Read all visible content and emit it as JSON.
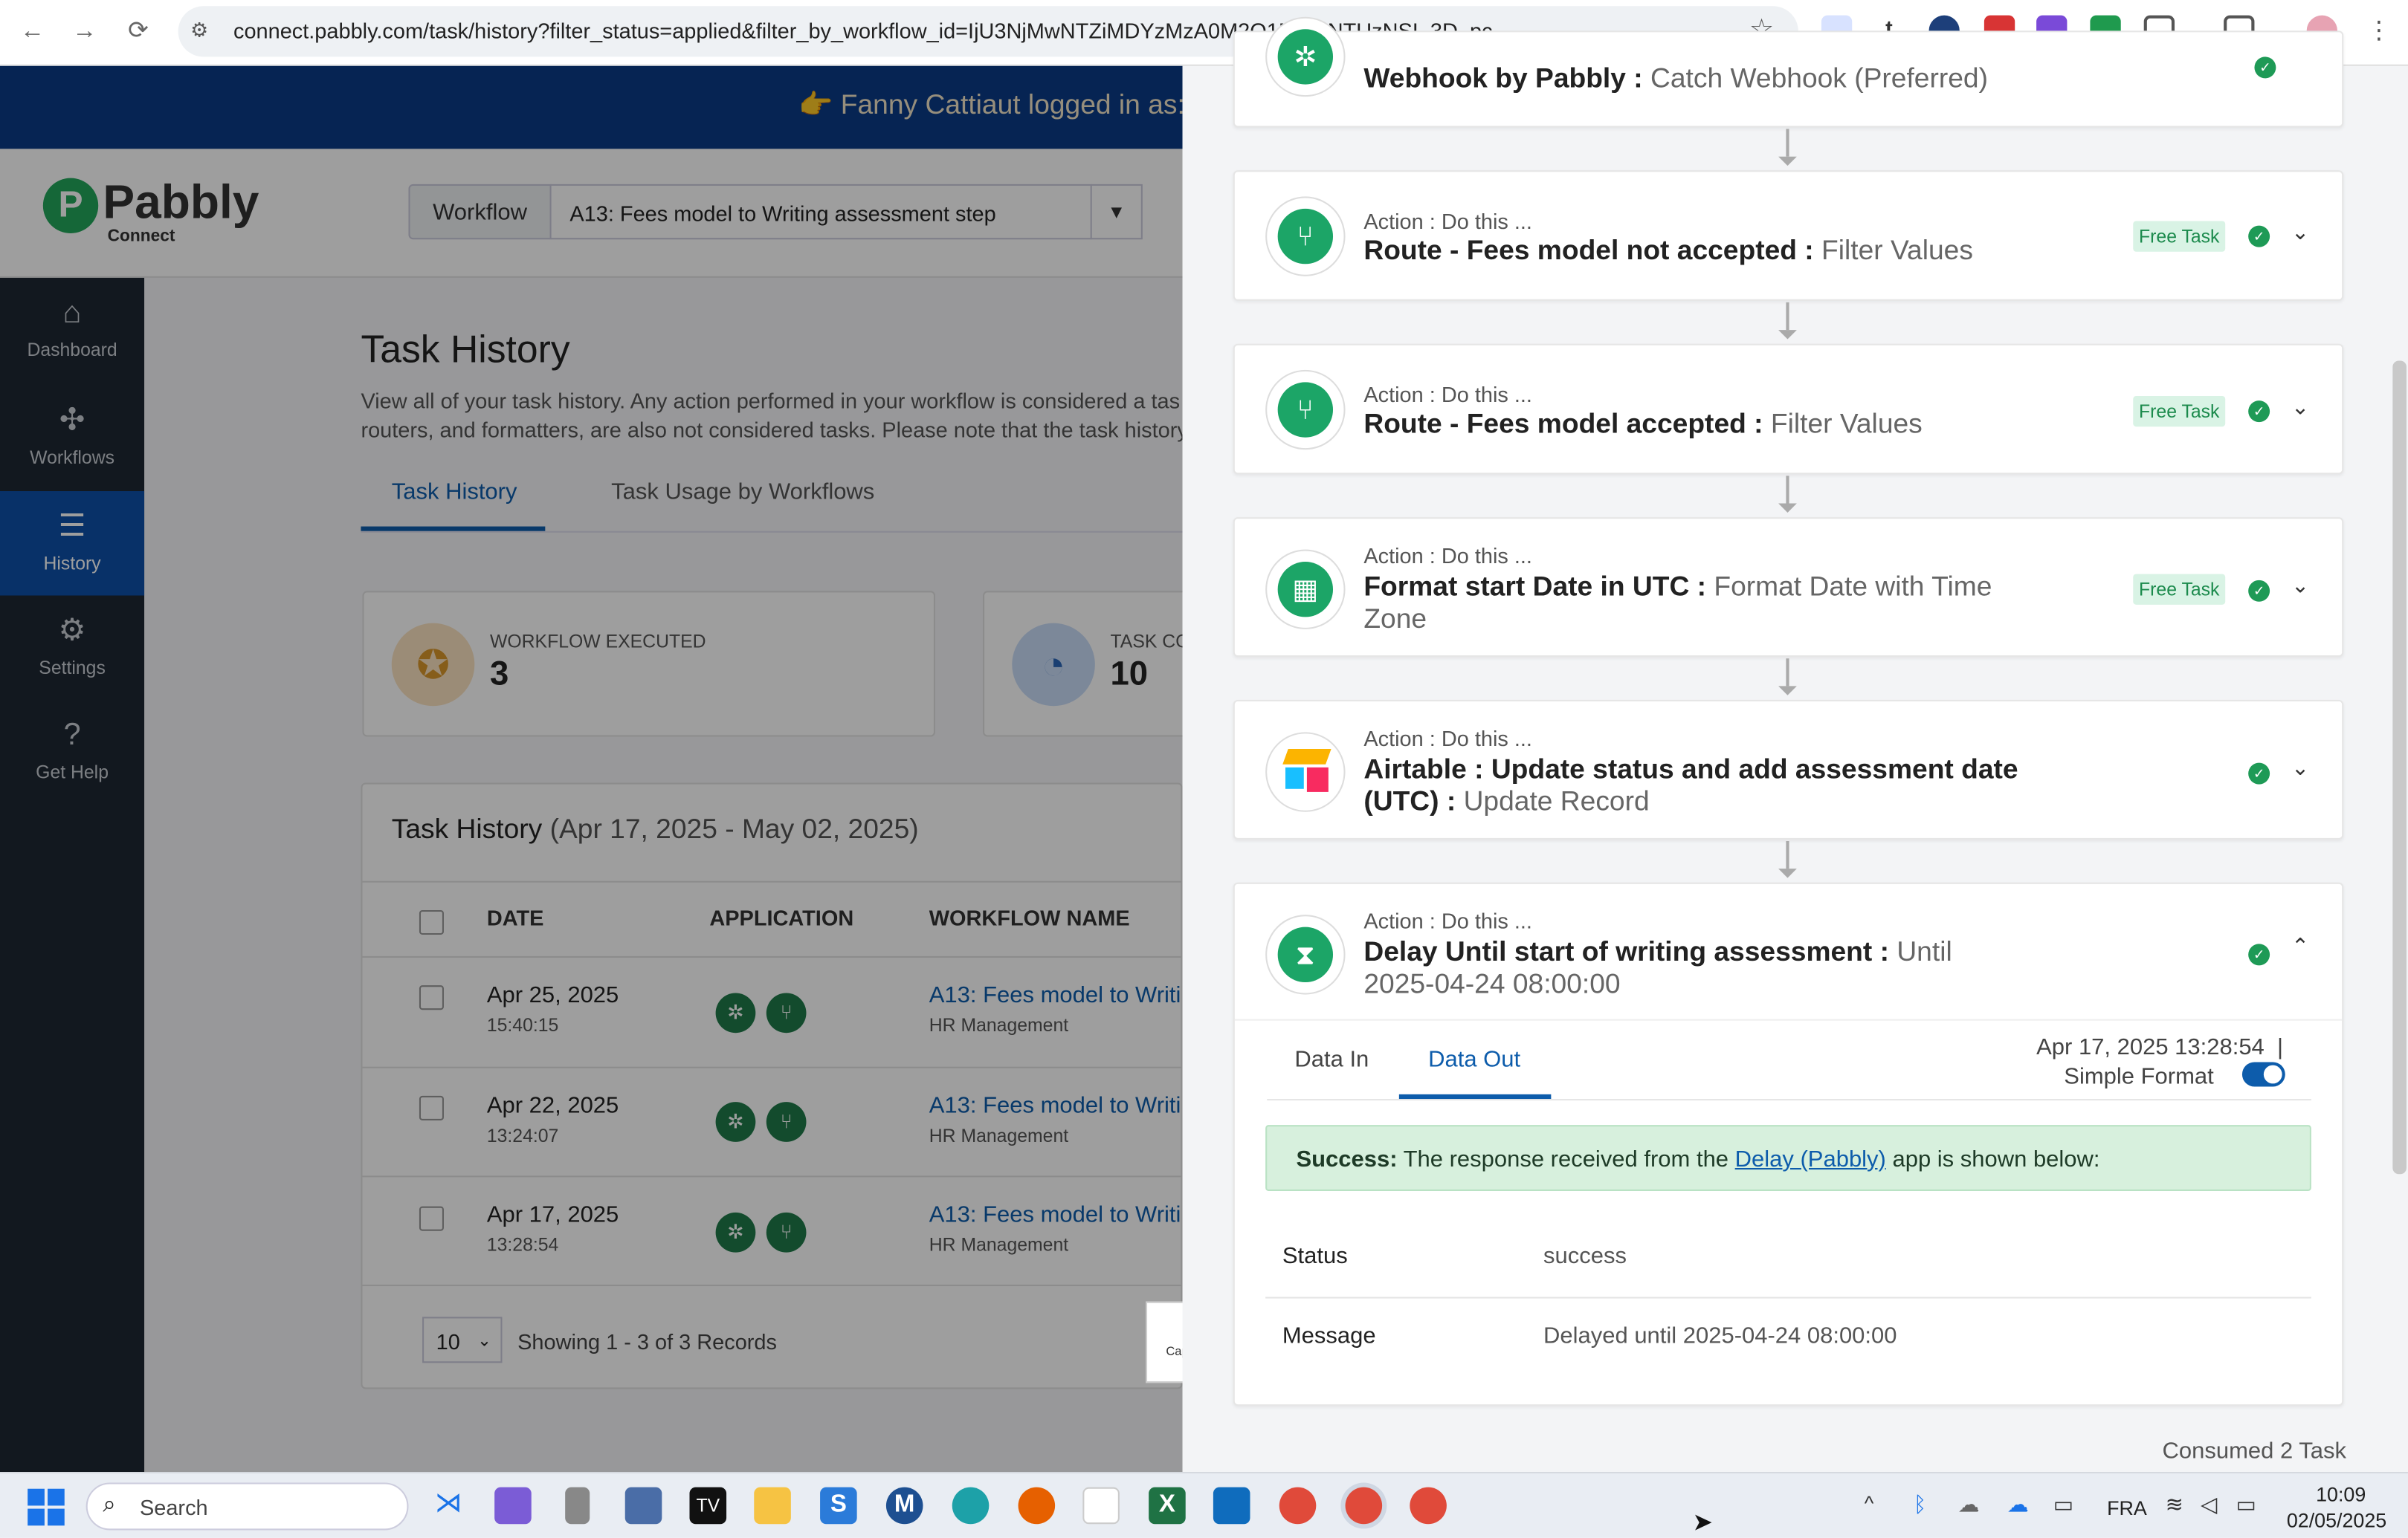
{
  "browser": {
    "url": "connect.pabbly.com/task/history?filter_status=applied&filter_by_workflow_id=IjU3NjMwNTZiMDYzMzA0M2Q1MjY0NTUzNSI_3D_pc"
  },
  "banner": {
    "text": "👉 Fanny Cattiaut logged in as:"
  },
  "logo": {
    "mark": "P",
    "name": "Pabbly",
    "sub": "Connect"
  },
  "workflow_filter": {
    "label": "Workflow",
    "value": "A13: Fees model to Writing assessment step"
  },
  "sidebar": {
    "items": [
      {
        "label": "Dashboard"
      },
      {
        "label": "Workflows"
      },
      {
        "label": "History"
      },
      {
        "label": "Settings"
      },
      {
        "label": "Get Help"
      }
    ]
  },
  "page": {
    "title": "Task History",
    "desc_line1": "View all of your task history. Any action performed in your workflow is considered a tas",
    "desc_line2": "routers, and formatters, are also not considered tasks. Please note that the task history",
    "tabs": [
      "Task History",
      "Task Usage by Workflows"
    ]
  },
  "stats": [
    {
      "label": "WORKFLOW EXECUTED",
      "value": "3"
    },
    {
      "label": "TASK CO",
      "value": "10"
    }
  ],
  "table": {
    "title": "Task History",
    "range": "(Apr 17, 2025 - May 02, 2025)",
    "headers": [
      "DATE",
      "APPLICATION",
      "WORKFLOW NAME"
    ],
    "rows": [
      {
        "date": "Apr 25, 2025",
        "time": "15:40:15",
        "name": "A13: Fees model to Writi",
        "sub": "HR Management"
      },
      {
        "date": "Apr 22, 2025",
        "time": "13:24:07",
        "name": "A13: Fees model to Writi",
        "sub": "HR Management"
      },
      {
        "date": "Apr 17, 2025",
        "time": "13:28:54",
        "name": "A13: Fees model to Writi",
        "sub": "HR Management"
      }
    ],
    "rows_per_page": "10",
    "showing": "Showing 1 - 3 of 3 Records"
  },
  "capslock": {
    "text": "Caps Lock Off"
  },
  "panel": {
    "kicker": "Action : Do this ...",
    "free_badge": "Free Task",
    "steps": [
      {
        "title": "Webhook by Pabbly : ",
        "app": "Catch Webhook (Preferred)"
      },
      {
        "title": "Route - Fees model not accepted : ",
        "app": "Filter Values"
      },
      {
        "title": "Route - Fees model accepted : ",
        "app": "Filter Values"
      },
      {
        "title": "Format start Date in UTC : ",
        "app": "Format Date with Time Zone"
      },
      {
        "title": "Airtable : Update status and add assessment date (UTC) : ",
        "app": "Update Record"
      },
      {
        "title": "Delay Until start of writing assessment : ",
        "app": "Until 2025-04-24 08:00:00"
      }
    ],
    "tabs": {
      "in": "Data In",
      "out": "Data Out"
    },
    "timestamp": "Apr 17, 2025 13:28:54  |",
    "simple_format": "Simple Format",
    "success_prefix": "Success:",
    "success_text": " The response received from the ",
    "success_link": "Delay (Pabbly)",
    "success_suffix": " app is shown below:",
    "kv": [
      {
        "key": "Status",
        "value": "success"
      },
      {
        "key": "Message",
        "value": "Delayed until 2025-04-24 08:00:00"
      }
    ],
    "consumed": "Consumed 2 Task"
  },
  "taskbar": {
    "search": "Search",
    "lang": "FRA",
    "time": "10:09",
    "date": "02/05/2025"
  },
  "colors": {
    "brand_blue": "#0d5cab",
    "pabbly_green": "#1ca567",
    "sidebar": "#1d2733",
    "banner": "#0b3a86"
  }
}
